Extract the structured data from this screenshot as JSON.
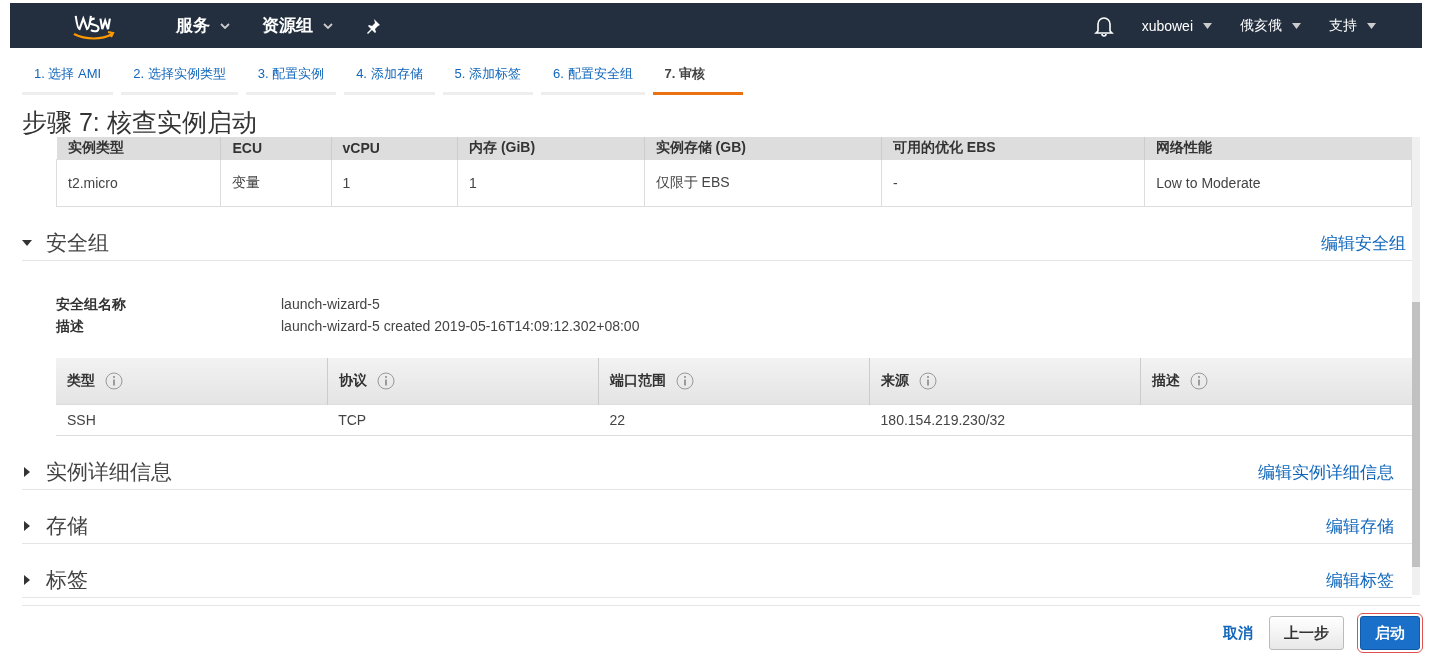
{
  "nav": {
    "menus": [
      {
        "label": "服务"
      },
      {
        "label": "资源组"
      }
    ],
    "user_menus": [
      {
        "label": "xubowei"
      },
      {
        "label": "俄亥俄"
      },
      {
        "label": "支持"
      }
    ]
  },
  "steps": [
    {
      "label": "1. 选择 AMI",
      "selected": false
    },
    {
      "label": "2. 选择实例类型",
      "selected": false
    },
    {
      "label": "3. 配置实例",
      "selected": false
    },
    {
      "label": "4. 添加存储",
      "selected": false
    },
    {
      "label": "5. 添加标签",
      "selected": false
    },
    {
      "label": "6. 配置安全组",
      "selected": false
    },
    {
      "label": "7. 审核",
      "selected": true
    }
  ],
  "page_title": "步骤 7: 核查实例启动",
  "instance_table": {
    "columns": [
      "实例类型",
      "ECU",
      "vCPU",
      "内存 (GiB)",
      "实例存储 (GB)",
      "可用的优化 EBS",
      "网络性能"
    ],
    "rows": [
      [
        "t2.micro",
        "变量",
        "1",
        "1",
        "仅限于 EBS",
        "-",
        "Low to Moderate"
      ]
    ]
  },
  "sections": [
    {
      "title": "安全组",
      "edit_link": "编辑安全组",
      "expanded": true,
      "details": [
        {
          "label": "安全组名称",
          "value": "launch-wizard-5"
        },
        {
          "label": "描述",
          "value": "launch-wizard-5 created 2019-05-16T14:09:12.302+08:00"
        }
      ],
      "rules_table": {
        "columns": [
          "类型",
          "协议",
          "端口范围",
          "来源",
          "描述"
        ],
        "rows": [
          [
            "SSH",
            "TCP",
            "22",
            "180.154.219.230/32",
            ""
          ]
        ]
      }
    },
    {
      "title": "实例详细信息",
      "edit_link": "编辑实例详细信息",
      "expanded": false
    },
    {
      "title": "存储",
      "edit_link": "编辑存储",
      "expanded": false
    },
    {
      "title": "标签",
      "edit_link": "编辑标签",
      "expanded": false
    }
  ],
  "footer": {
    "cancel": "取消",
    "back": "上一步",
    "launch": "启动"
  }
}
